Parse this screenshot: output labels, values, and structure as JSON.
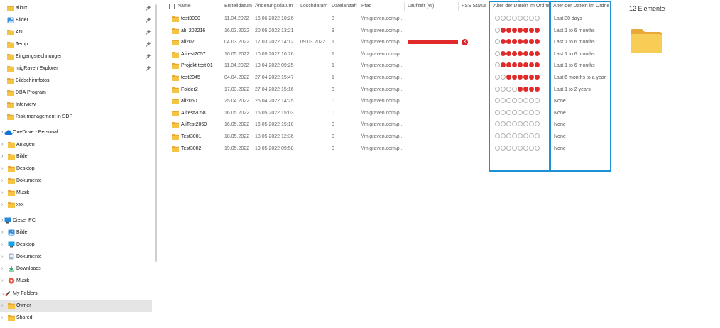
{
  "sidebar": {
    "items": [
      {
        "label": "aikux",
        "icon": "folder-icon",
        "pinned": true,
        "chevron": false
      },
      {
        "label": "Bilder",
        "icon": "pictures-icon",
        "pinned": true,
        "chevron": false
      },
      {
        "label": "AN",
        "icon": "folder-icon",
        "pinned": true,
        "chevron": false
      },
      {
        "label": "Temp",
        "icon": "folder-icon",
        "pinned": true,
        "chevron": false
      },
      {
        "label": "Eingangsrechnungen",
        "icon": "folder-icon",
        "pinned": true,
        "chevron": false
      },
      {
        "label": "migRaven Explorer",
        "icon": "folder-icon",
        "pinned": true,
        "chevron": false
      },
      {
        "label": "Bildschirmfotos",
        "icon": "folder-icon",
        "pinned": false,
        "chevron": false
      },
      {
        "label": "DBA Program",
        "icon": "folder-icon",
        "pinned": false,
        "chevron": false
      },
      {
        "label": "Interview",
        "icon": "folder-icon",
        "pinned": false,
        "chevron": false
      },
      {
        "label": "Risk management in SDP",
        "icon": "folder-icon",
        "pinned": false,
        "chevron": false
      },
      {
        "label": "OneDrive - Personal",
        "icon": "cloud-icon",
        "pinned": false,
        "chevron": true,
        "level": 0
      },
      {
        "label": "Anlagen",
        "icon": "folder-icon",
        "pinned": false,
        "chevron": true,
        "level": 1
      },
      {
        "label": "Bilder",
        "icon": "folder-icon",
        "pinned": false,
        "chevron": true,
        "level": 1
      },
      {
        "label": "Desktop",
        "icon": "folder-icon",
        "pinned": false,
        "chevron": true,
        "level": 1
      },
      {
        "label": "Dokumente",
        "icon": "folder-icon",
        "pinned": false,
        "chevron": true,
        "level": 1
      },
      {
        "label": "Musik",
        "icon": "folder-icon",
        "pinned": false,
        "chevron": true,
        "level": 1
      },
      {
        "label": "xxx",
        "icon": "folder-icon",
        "pinned": false,
        "chevron": true,
        "level": 1
      },
      {
        "label": "Dieser PC",
        "icon": "pc-icon",
        "pinned": false,
        "chevron": true,
        "level": 0
      },
      {
        "label": "Bilder",
        "icon": "pictures-icon",
        "pinned": false,
        "chevron": true,
        "level": 1
      },
      {
        "label": "Desktop",
        "icon": "desktop-icon",
        "pinned": false,
        "chevron": true,
        "level": 1
      },
      {
        "label": "Dokumente",
        "icon": "documents-icon",
        "pinned": false,
        "chevron": true,
        "level": 1
      },
      {
        "label": "Downloads",
        "icon": "download-icon",
        "pinned": false,
        "chevron": true,
        "level": 1
      },
      {
        "label": "Musik",
        "icon": "music-icon",
        "pinned": false,
        "chevron": true,
        "level": 1
      },
      {
        "label": "My Folders",
        "icon": "myfolders-icon",
        "pinned": false,
        "chevron": true,
        "level": 0,
        "expanded": true
      },
      {
        "label": "Owner",
        "icon": "folder-icon",
        "pinned": false,
        "chevron": true,
        "level": 1,
        "selected": true
      },
      {
        "label": "Shared",
        "icon": "folder-icon",
        "pinned": false,
        "chevron": true,
        "level": 1
      }
    ]
  },
  "columns": {
    "name": "Name",
    "created": "Erstelldatum",
    "modified": "Änderungsdatum",
    "deleted": "Löschdatum",
    "count": "Dateianzahl",
    "path": "Pfad",
    "runtime": "Laufzeit (%)",
    "fss": "FSS Status",
    "age_dots": "Alter der Datein im Ordner",
    "age_label": "Alter der Datein im Ordne..."
  },
  "rows": [
    {
      "name": "test3000",
      "created": "11.04.2022",
      "modified": "16.06.2022 10:26",
      "deleted": "",
      "count": "3",
      "path": "\\\\migraven.com\\p...",
      "dots": 0,
      "age": "Last 30 days"
    },
    {
      "name": "ali_202216",
      "created": "16.03.2022",
      "modified": "20.05.2022 13:21",
      "deleted": "",
      "count": "3",
      "path": "\\\\migraven.com\\p...",
      "dots": 7,
      "age": "Last 1 to 6 months"
    },
    {
      "name": "ali202",
      "created": "04.03.2022",
      "modified": "17.03.2022 14:12",
      "deleted": "09.03.2022",
      "count": "1",
      "path": "\\\\migraven.com\\p...",
      "dots": 7,
      "age": "Last 1 to 6 months",
      "runtime": 100,
      "fss_error": true
    },
    {
      "name": "Alitest2057",
      "created": "10.05.2022",
      "modified": "10.05.2022 10:26",
      "deleted": "",
      "count": "1",
      "path": "\\\\migraven.com\\p...",
      "dots": 7,
      "age": "Last 1 to 6 months"
    },
    {
      "name": "Projekt test 01",
      "created": "11.04.2022",
      "modified": "19.04.2022 09:25",
      "deleted": "",
      "count": "1",
      "path": "\\\\migraven.com\\p...",
      "dots": 7,
      "age": "Last 1 to 6 months"
    },
    {
      "name": "test2045",
      "created": "04.04.2022",
      "modified": "27.04.2022 15:47",
      "deleted": "",
      "count": "1",
      "path": "\\\\migraven.com\\p...",
      "dots": 6,
      "age": "Last 6 months to a year"
    },
    {
      "name": "Folder2",
      "created": "17.03.2022",
      "modified": "27.04.2022 15:16",
      "deleted": "",
      "count": "3",
      "path": "\\\\migraven.com\\p...",
      "dots": 4,
      "age": "Last 1 to 2 years"
    },
    {
      "name": "ali2050",
      "created": "25.04.2022",
      "modified": "25.04.2022 14:25",
      "deleted": "",
      "count": "0",
      "path": "\\\\migraven.com\\p...",
      "dots": 0,
      "age": "None"
    },
    {
      "name": "Alitest2058",
      "created": "16.05.2022",
      "modified": "16.05.2022 15:03",
      "deleted": "",
      "count": "0",
      "path": "\\\\migraven.com\\p...",
      "dots": 0,
      "age": "None"
    },
    {
      "name": "AliTest2059",
      "created": "16.05.2022",
      "modified": "16.05.2022 15:10",
      "deleted": "",
      "count": "0",
      "path": "\\\\migraven.com\\p...",
      "dots": 0,
      "age": "None"
    },
    {
      "name": "Test3001",
      "created": "18.05.2022",
      "modified": "18.05.2022 12:36",
      "deleted": "",
      "count": "0",
      "path": "\\\\migraven.com\\p...",
      "dots": 0,
      "age": "None"
    },
    {
      "name": "Test3002",
      "created": "19.05.2022",
      "modified": "19.05.2022 09:58",
      "deleted": "",
      "count": "0",
      "path": "\\\\migraven.com\\p...",
      "dots": 0,
      "age": "None"
    }
  ],
  "details": {
    "count_label": "12 Elemente"
  },
  "colors": {
    "accent": "#1e90d6",
    "dot_on": "#e12b2b",
    "bar": "#e12b2b",
    "folder": "#f6c444"
  }
}
